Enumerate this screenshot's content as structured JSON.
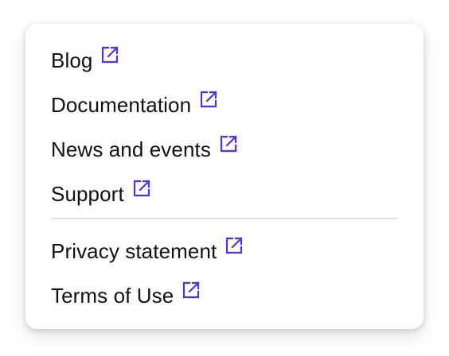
{
  "menu": {
    "primary_items": [
      {
        "label": "Blog",
        "icon": "external-link-icon"
      },
      {
        "label": "Documentation",
        "icon": "external-link-icon"
      },
      {
        "label": "News and events",
        "icon": "external-link-icon"
      },
      {
        "label": "Support",
        "icon": "external-link-icon"
      }
    ],
    "secondary_items": [
      {
        "label": "Privacy statement",
        "icon": "external-link-icon"
      },
      {
        "label": "Terms of Use",
        "icon": "external-link-icon"
      }
    ]
  },
  "colors": {
    "text": "#111111",
    "icon_accent": "#4f2ff0",
    "divider": "#e2e2e2",
    "card_background": "#ffffff"
  }
}
